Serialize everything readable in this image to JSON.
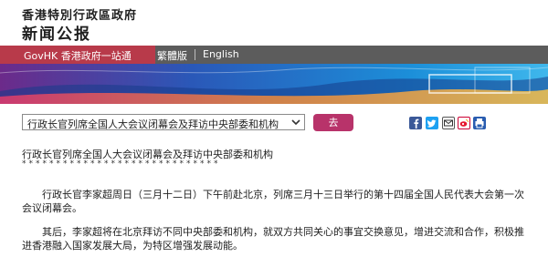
{
  "header": {
    "dept": "香港特別行政區政府",
    "site": "新闻公报"
  },
  "nav": {
    "home": "GovHK 香港政府一站通",
    "traditional": "繁體版",
    "english": "English"
  },
  "selector": {
    "selected": "行政长官列席全国人大会议闭幕会及拜访中央部委和机构",
    "go": "去"
  },
  "share_icons": [
    "facebook-icon",
    "twitter-icon",
    "email-icon",
    "weibo-icon",
    "print-icon"
  ],
  "colors": {
    "nav_home": "#b83a4a",
    "nav_bar": "#5c5c5c",
    "go_button": "#b8336a"
  },
  "article": {
    "title": "行政长官列席全国人大会议闭幕会及拜访中央部委和机构",
    "stars": "*****************************",
    "p1": "行政长官李家超周日（三月十二日）下午前赴北京，列席三月十三日举行的第十四届全国人民代表大会第一次会议闭幕会。",
    "p2": "其后，李家超将在北京拜访不同中央部委和机构，就双方共同关心的事宜交换意见，增进交流和合作，积极推进香港融入国家发展大局，为特区增强发展动能。"
  }
}
